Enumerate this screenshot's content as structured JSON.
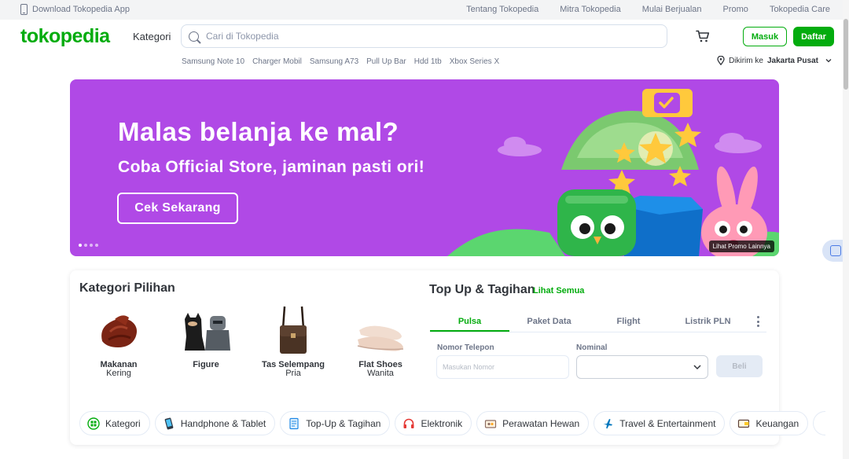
{
  "topbar": {
    "download_label": "Download Tokopedia App",
    "links": [
      "Tentang Tokopedia",
      "Mitra Tokopedia",
      "Mulai Berjualan",
      "Promo",
      "Tokopedia Care"
    ]
  },
  "header": {
    "logo": "tokopedia",
    "kategori_label": "Kategori",
    "search_placeholder": "Cari di Tokopedia",
    "login_label": "Masuk",
    "register_label": "Daftar",
    "trending": [
      "Samsung Note 10",
      "Charger Mobil",
      "Samsung A73",
      "Pull Up Bar",
      "Hdd 1tb",
      "Xbox Series X"
    ],
    "location_prefix": "Dikirim ke",
    "location_city": "Jakarta Pusat"
  },
  "banner": {
    "headline": "Malas belanja ke mal?",
    "subline": "Coba Official Store, jaminan pasti ori!",
    "cta": "Cek Sekarang",
    "promo_link": "Lihat Promo Lainnya",
    "slide_count": 4,
    "active_slide": 1
  },
  "kategori_pilihan": {
    "title": "Kategori Pilihan",
    "items": [
      {
        "name": "Makanan",
        "sub": "Kering"
      },
      {
        "name": "Figure",
        "sub": ""
      },
      {
        "name": "Tas Selempang",
        "sub": "Pria"
      },
      {
        "name": "Flat Shoes",
        "sub": "Wanita"
      }
    ]
  },
  "topup": {
    "title": "Top Up & Tagihan",
    "see_all": "Lihat Semua",
    "tabs": [
      "Pulsa",
      "Paket Data",
      "Flight",
      "Listrik PLN"
    ],
    "active_tab": 0,
    "phone_label": "Nomor Telepon",
    "phone_placeholder": "Masukan Nomor",
    "nominal_label": "Nominal",
    "buy_label": "Beli"
  },
  "category_chips": [
    "Kategori",
    "Handphone & Tablet",
    "Top-Up & Tagihan",
    "Elektronik",
    "Perawatan Hewan",
    "Travel & Entertainment",
    "Keuangan"
  ],
  "colors": {
    "brand_green": "#03ac0e",
    "banner_purple": "#b049e6",
    "text_dark": "#31353b",
    "text_muted": "#6d7588"
  }
}
